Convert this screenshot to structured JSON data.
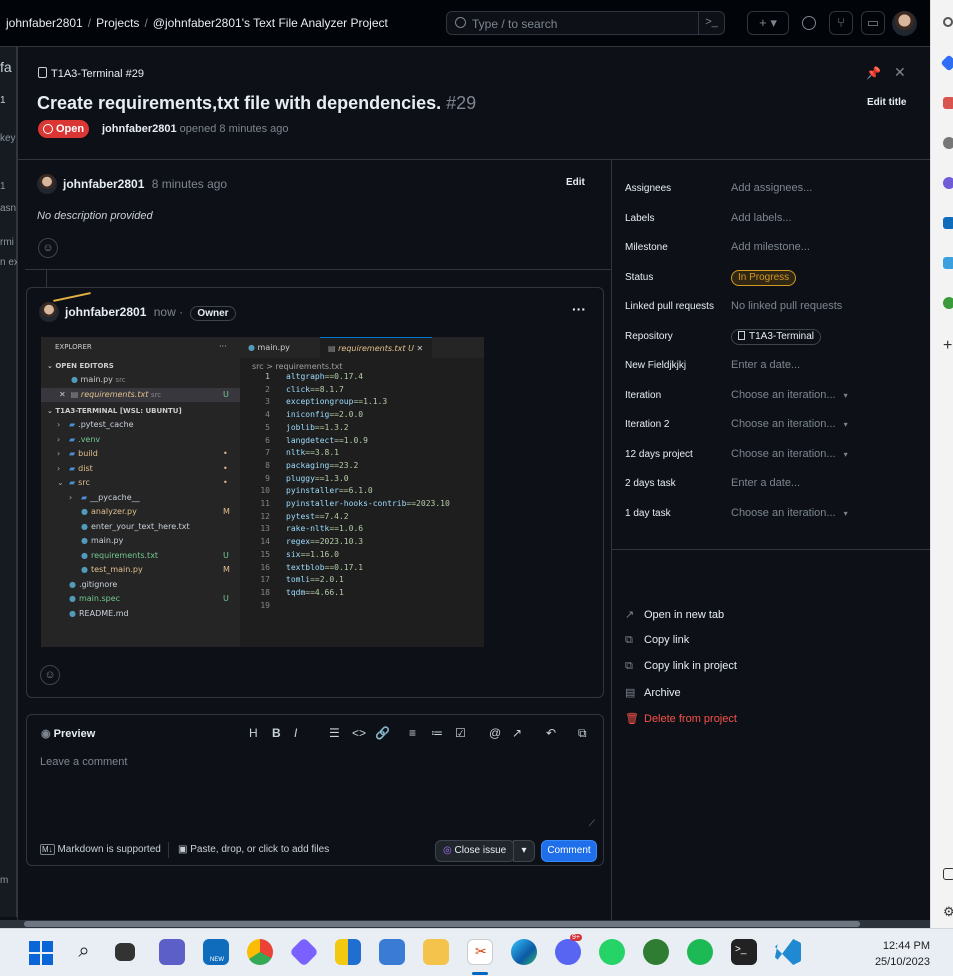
{
  "breadcrumb": {
    "user": "johnfaber2801",
    "projects": "Projects",
    "project": "@johnfaber2801's Text File Analyzer Project",
    "sep": "/"
  },
  "search": {
    "placeholder": "Type / to search",
    "terminal_glyph": ">_"
  },
  "topbar_buttons": {
    "plus": "+ ▾"
  },
  "left_fragments": [
    "fa",
    "1",
    "key",
    "1",
    "asn`",
    "rmi",
    "n ex",
    "m"
  ],
  "issue": {
    "ref": "T1A3-Terminal #29",
    "title": "Create requirements,txt file with dependencies.",
    "number": "#29",
    "status": "Open",
    "author": "johnfaber2801",
    "opened_text": "opened 8 minutes ago",
    "edit_title": "Edit title"
  },
  "first_comment": {
    "author": "johnfaber2801",
    "time": "8 minutes ago",
    "edit": "Edit",
    "body": "No description provided"
  },
  "second_comment": {
    "author": "johnfaber2801",
    "time": "now",
    "dot": "·",
    "role": "Owner",
    "menu": "···"
  },
  "vscode": {
    "explorer_title": "EXPLORER",
    "open_editors": "OPEN EDITORS",
    "open_files": [
      {
        "name": "main.py",
        "hint": "src",
        "badge": ""
      },
      {
        "name": "requirements.txt",
        "hint": "src",
        "badge": "U"
      }
    ],
    "workspace": "T1A3-TERMINAL [WSL: UBUNTU]",
    "tree": [
      {
        "name": ".pytest_cache",
        "badge": ""
      },
      {
        "name": ".venv",
        "badge": ""
      },
      {
        "name": "build",
        "badge": "•"
      },
      {
        "name": "dist",
        "badge": "•"
      },
      {
        "name": "src",
        "badge": "•"
      },
      {
        "name": "__pycache__",
        "badge": ""
      },
      {
        "name": "analyzer.py",
        "badge": "M"
      },
      {
        "name": "enter_your_text_here.txt",
        "badge": ""
      },
      {
        "name": "main.py",
        "badge": ""
      },
      {
        "name": "requirements.txt",
        "badge": "U"
      },
      {
        "name": "test_main.py",
        "badge": "M"
      },
      {
        "name": ".gitignore",
        "badge": ""
      },
      {
        "name": "main.spec",
        "badge": "U"
      },
      {
        "name": "README.md",
        "badge": ""
      }
    ],
    "tabs": [
      {
        "name": "main.py"
      },
      {
        "name": "requirements.txt U"
      }
    ],
    "path": "src > requirements.txt",
    "lines": [
      [
        "altgraph",
        "==0.17.4"
      ],
      [
        "click",
        "==8.1.7"
      ],
      [
        "exceptiongroup",
        "==1.1.3"
      ],
      [
        "iniconfig",
        "==2.0.0"
      ],
      [
        "joblib",
        "==1.3.2"
      ],
      [
        "langdetect",
        "==1.0.9"
      ],
      [
        "nltk",
        "==3.8.1"
      ],
      [
        "packaging",
        "==23.2"
      ],
      [
        "pluggy",
        "==1.3.0"
      ],
      [
        "pyinstaller",
        "==6.1.0"
      ],
      [
        "pyinstaller-hooks-contrib",
        "==2023.10"
      ],
      [
        "pytest",
        "==7.4.2"
      ],
      [
        "rake-nltk",
        "==1.0.6"
      ],
      [
        "regex",
        "==2023.10.3"
      ],
      [
        "six",
        "==1.16.0"
      ],
      [
        "textblob",
        "==0.17.1"
      ],
      [
        "tomli",
        "==2.0.1"
      ],
      [
        "tqdm",
        "==4.66.1"
      ],
      [
        "",
        ""
      ]
    ]
  },
  "composer": {
    "preview": "Preview",
    "tools": [
      "H",
      "B",
      "I",
      "☰",
      "<>",
      "🔗",
      "≡",
      "≔",
      "☑",
      "@",
      "↗",
      "↶",
      "⧉"
    ],
    "placeholder": "Leave a comment",
    "markdown": "Markdown is supported",
    "attach": "Paste, drop, or click to add files",
    "close_issue": "Close issue",
    "comment": "Comment"
  },
  "sidebar": {
    "fields": [
      {
        "label": "Assignees",
        "value": "Add assignees..."
      },
      {
        "label": "Labels",
        "value": "Add labels..."
      },
      {
        "label": "Milestone",
        "value": "Add milestone..."
      },
      {
        "label": "Status",
        "value": "In Progress"
      },
      {
        "label": "Linked pull requests",
        "value": "No linked pull requests"
      },
      {
        "label": "Repository",
        "value": "T1A3-Terminal"
      },
      {
        "label": "New Fieldjkjkj",
        "value": "Enter a date..."
      },
      {
        "label": "Iteration",
        "value": "Choose an iteration..."
      },
      {
        "label": "Iteration 2",
        "value": "Choose an iteration..."
      },
      {
        "label": "12 days project",
        "value": "Choose an iteration..."
      },
      {
        "label": "2 days task",
        "value": "Enter a date..."
      },
      {
        "label": "1 day task",
        "value": "Choose an iteration..."
      }
    ],
    "actions": [
      {
        "label": "Open in new tab",
        "icon": "↗"
      },
      {
        "label": "Copy link",
        "icon": "⧉"
      },
      {
        "label": "Copy link in project",
        "icon": "⧉"
      },
      {
        "label": "Archive",
        "icon": "▤"
      },
      {
        "label": "Delete from project",
        "icon": "🗑"
      }
    ]
  },
  "taskbar": {
    "time": "12:44 PM",
    "date": "25/10/2023",
    "discord_badge": "9+",
    "outlook_badge": "NEW"
  },
  "colors": {
    "bg": "#0d1117",
    "border": "#30363d",
    "open_red": "#da3633",
    "in_progress": "#d29922",
    "comment_blue": "#1f6feb",
    "danger": "#f85149"
  }
}
